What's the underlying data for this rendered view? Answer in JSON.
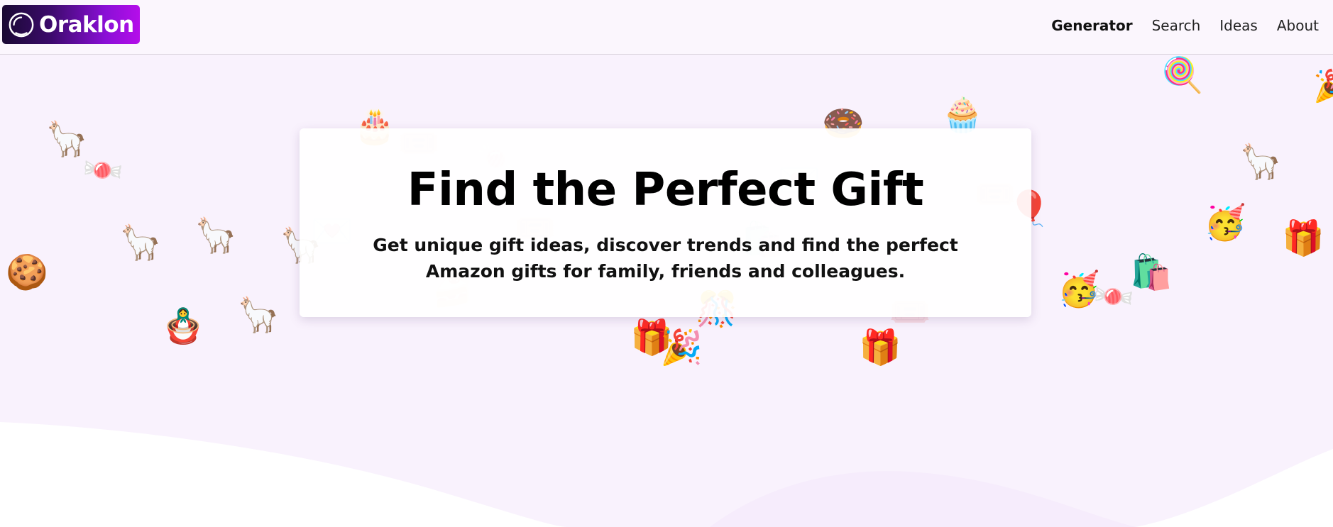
{
  "header": {
    "logo_text": "Oraklon",
    "nav": [
      {
        "label": "Generator",
        "active": true
      },
      {
        "label": "Search",
        "active": false
      },
      {
        "label": "Ideas",
        "active": false
      },
      {
        "label": "About",
        "active": false
      }
    ]
  },
  "hero": {
    "title": "Find the Perfect Gift",
    "subtitle": "Get unique gift ideas, discover trends and find the perfect Amazon gifts for family, friends and colleagues."
  },
  "decorations": {
    "pinata": "🦙",
    "candy": "🍬",
    "cookie": "🍪",
    "nesting_doll": "🪆",
    "cake": "🎂",
    "donut": "🍩",
    "cupcake": "🧁",
    "lollipop": "🍭",
    "party_popper": "🎉",
    "partying_face": "🥳",
    "shopping_bags": "🛍️",
    "gift": "🎁",
    "balloon": "🎈",
    "love_letter": "💌",
    "ticket": "🎟️",
    "shortcake": "🍰",
    "cactus_bag": "🎊"
  },
  "colors": {
    "accent_gradient_start": "#1a0933",
    "accent_gradient_end": "#b50eea",
    "page_background": "#f9f2fd"
  }
}
